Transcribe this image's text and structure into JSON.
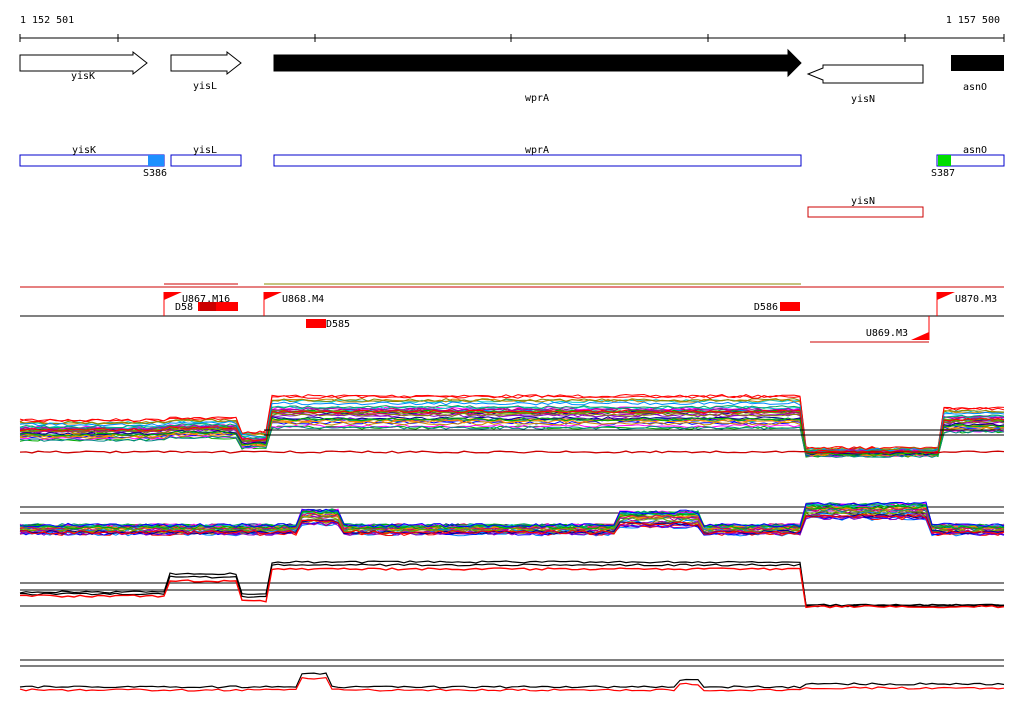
{
  "coordinates": {
    "start": "1 152 501",
    "end": "1 157 500"
  },
  "genes": [
    {
      "name": "yisK",
      "strand": "+",
      "highlight": false
    },
    {
      "name": "yisL",
      "strand": "+",
      "highlight": false
    },
    {
      "name": "wprA",
      "strand": "+",
      "highlight": true
    },
    {
      "name": "yisN",
      "strand": "-",
      "highlight": false
    },
    {
      "name": "asnO",
      "strand": "+",
      "highlight": true
    }
  ],
  "annotation_boxes": [
    {
      "name": "yisK",
      "color": "#0000cc"
    },
    {
      "name": "yisL",
      "color": "#0000cc"
    },
    {
      "name": "wprA",
      "color": "#0000cc"
    },
    {
      "name": "asnO",
      "color": "#0000cc"
    },
    {
      "name": "yisN",
      "color": "#cc0000"
    }
  ],
  "markers": [
    {
      "label": "S386",
      "color": "#1e90ff"
    },
    {
      "label": "S387",
      "color": "#00dd00"
    }
  ],
  "units": [
    {
      "label": "U867.M16"
    },
    {
      "label": "U868.M4"
    },
    {
      "label": "U869.M3"
    },
    {
      "label": "U870.M3"
    }
  ],
  "downshifts": [
    {
      "label": "D58"
    },
    {
      "label": "D585"
    },
    {
      "label": "D586"
    }
  ],
  "colors": {
    "gene_fill_highlight": "#000000",
    "annotation_line": "#cc0000",
    "feature_red": "#ff0000",
    "track_black": "#000000"
  }
}
